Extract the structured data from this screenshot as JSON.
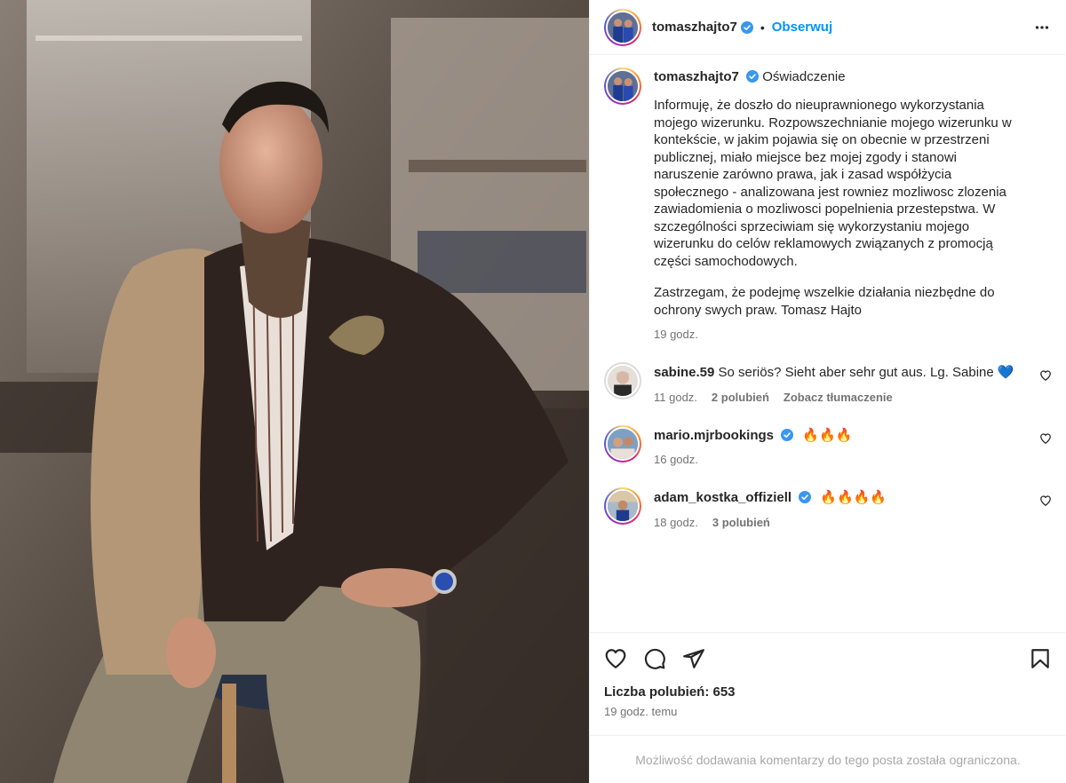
{
  "post": {
    "image_alt": "Tomasz Hajto portrait",
    "author": "tomaszhajto7",
    "follow_label": "Obserwuj",
    "separator": "•"
  },
  "caption": {
    "username": "tomaszhajto7",
    "title": "Oświadczenie",
    "paragraph1": "Informuję, że doszło do nieuprawnionego wykorzystania mojego wizerunku. Rozpowszechnianie mojego wizerunku w kontekście, w jakim pojawia się on obecnie w przestrzeni publicznej, miało miejsce bez mojej zgody i stanowi naruszenie zarówno prawa, jak i zasad współżycia społecznego - analizowana jest rowniez mozliwosc zlozenia zawiadomienia o mozliwosci popelnienia przestepstwa. W szczególności sprzeciwiam się wykorzystaniu mojego wizerunku do celów reklamowych związanych z promocją części samochodowych.",
    "paragraph2": "Zastrzegam, że podejmę wszelkie działania niezbędne do ochrony swych praw. Tomasz Hajto",
    "time": "19 godz."
  },
  "comments": [
    {
      "username": "sabine.59",
      "verified": false,
      "text": "So seriös? Sieht aber sehr gut aus. Lg. Sabine 💙",
      "time": "11 godz.",
      "likes": "2 polubień",
      "translate": "Zobacz tłumaczenie"
    },
    {
      "username": "mario.mjrbookings",
      "verified": true,
      "text": "🔥🔥🔥",
      "time": "16 godz."
    },
    {
      "username": "adam_kostka_offiziell",
      "verified": true,
      "text": "🔥🔥🔥🔥",
      "time": "18 godz.",
      "likes": "3 polubień"
    }
  ],
  "actions": {
    "likes_label": "Liczba polubień: 653",
    "time_ago": "19 godz. temu"
  },
  "footer": {
    "restricted_text": "Możliwość dodawania komentarzy do tego posta została ograniczona."
  },
  "colors": {
    "link": "#0095f6",
    "verified": "#3897f0",
    "muted": "#737373",
    "border": "#efefef"
  }
}
